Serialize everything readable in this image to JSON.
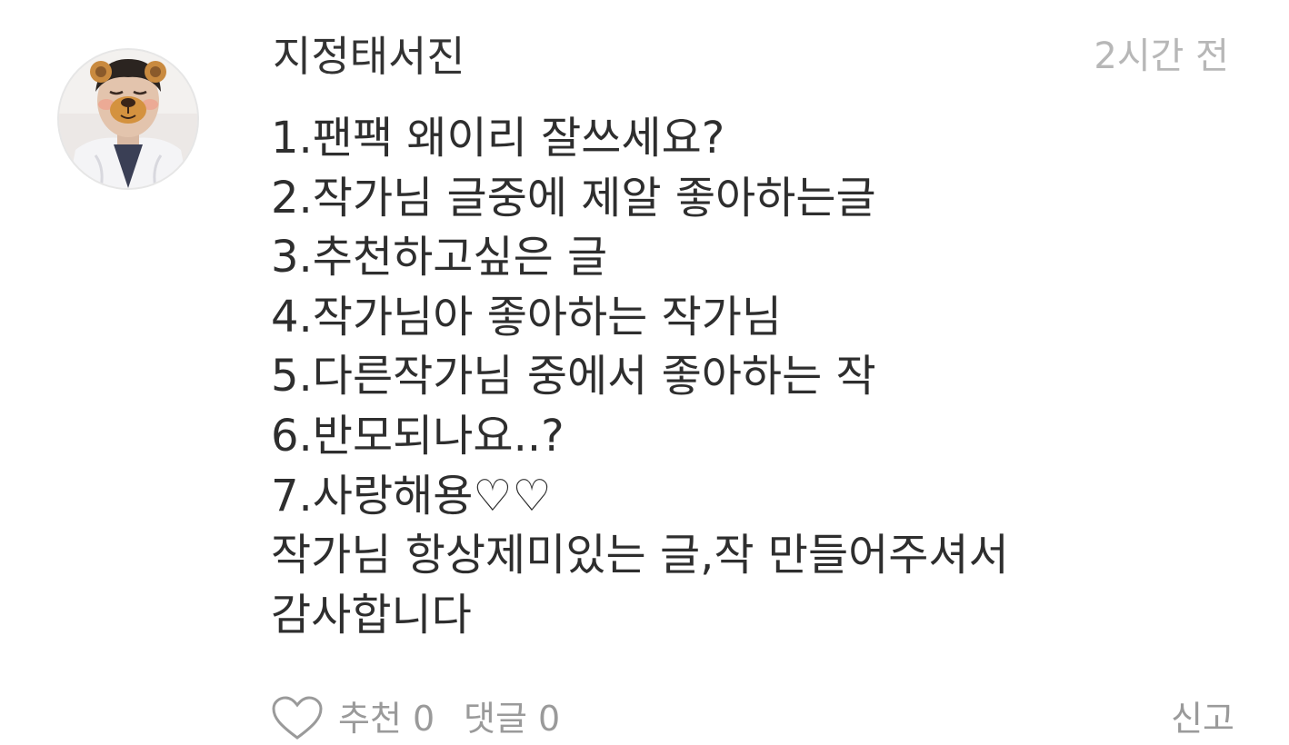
{
  "comment": {
    "author": "지정태서진",
    "time": "2시간 전",
    "lines": [
      "1.팬팩 왜이리 잘쓰세요?",
      "2.작가님 글중에 제알 좋아하는글",
      "3.추천하고싶은 글",
      "4.작가님아 좋아하는 작가님",
      "5.다른작가님 중에서 좋아하는 작",
      "6.반모되나요..?",
      "7.사랑해용♡♡",
      "작가님 항상제미있는 글,작 만들어주셔서",
      "감사합니다"
    ]
  },
  "actions": {
    "like_icon": "heart-icon",
    "recommend_label": "추천 0",
    "reply_label": "댓글 0",
    "report_label": "신고"
  },
  "colors": {
    "text": "#2e2e2e",
    "muted": "#b7b7b7",
    "action": "#9a9a9a"
  }
}
